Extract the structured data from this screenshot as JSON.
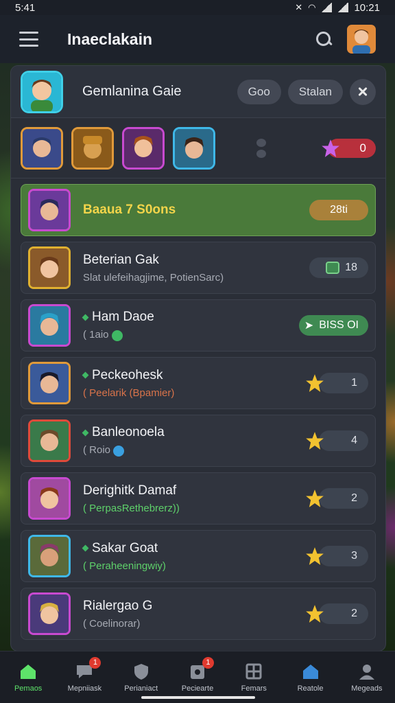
{
  "status_bar": {
    "time": "5:41",
    "clock_right": "10:21"
  },
  "app": {
    "title": "Inaeclakain"
  },
  "panel": {
    "title": "Gemlanina Gaie",
    "buttons": {
      "first": "Goo",
      "second": "Stalan"
    }
  },
  "team": {
    "counter_value": "0"
  },
  "highlight_row": {
    "title": "Baaua 7 S0ons",
    "value": "28ti"
  },
  "rows": [
    {
      "name": "Beterian Gak",
      "sub": "Slat ulefeihagjime, PotienSarc)",
      "value": "18",
      "kind": "square"
    },
    {
      "name": "Ham Daoe",
      "sub": "( 1aio",
      "value": "BISS  OI",
      "kind": "green"
    },
    {
      "name": "Peckeohesk",
      "sub": "( Peelarik (Bpamier)",
      "value": "1",
      "kind": "star"
    },
    {
      "name": "Banleonoela",
      "sub": "( Roio",
      "value": "4",
      "kind": "star"
    },
    {
      "name": "Derighitk Damaf",
      "sub": "( PerpasRethebrerz))",
      "value": "2",
      "kind": "star"
    },
    {
      "name": "Sakar Goat",
      "sub": "( Peraheeningwiy)",
      "value": "3",
      "kind": "star"
    },
    {
      "name": "Rialergao G",
      "sub": "( Coelinorar)",
      "value": "2",
      "kind": "star"
    }
  ],
  "bottom_nav": [
    {
      "label": "Pemaos",
      "icon": "home-icon",
      "active": true
    },
    {
      "label": "Mepniiask",
      "icon": "chat-icon",
      "badge": "1"
    },
    {
      "label": "Perianiact",
      "icon": "shield-icon"
    },
    {
      "label": "Peciearte",
      "icon": "puzzle-icon",
      "badge": "1"
    },
    {
      "label": "Femars",
      "icon": "grid-icon"
    },
    {
      "label": "Reatole",
      "icon": "house-icon"
    },
    {
      "label": "Megeads",
      "icon": "profile-icon"
    }
  ],
  "colors": {
    "accent_green": "#5ee36a",
    "highlight_row": "#4a7a3a",
    "counter_red": "#b8303c",
    "star_gold": "#f2c230"
  }
}
